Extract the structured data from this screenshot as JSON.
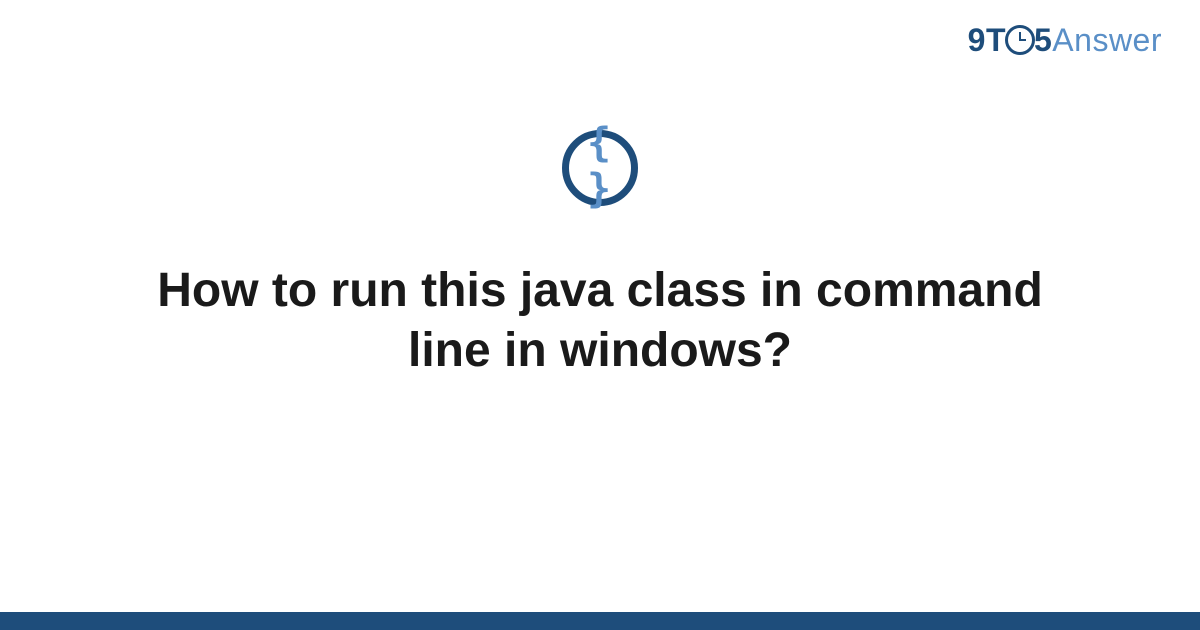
{
  "logo": {
    "nine": "9",
    "t": "T",
    "five": "5",
    "answer": "Answer"
  },
  "topic_icon_glyph": "{ }",
  "title": "How to run this java class in command line in windows?",
  "colors": {
    "brand_dark": "#1e4d7b",
    "brand_light": "#5a8fc7"
  }
}
